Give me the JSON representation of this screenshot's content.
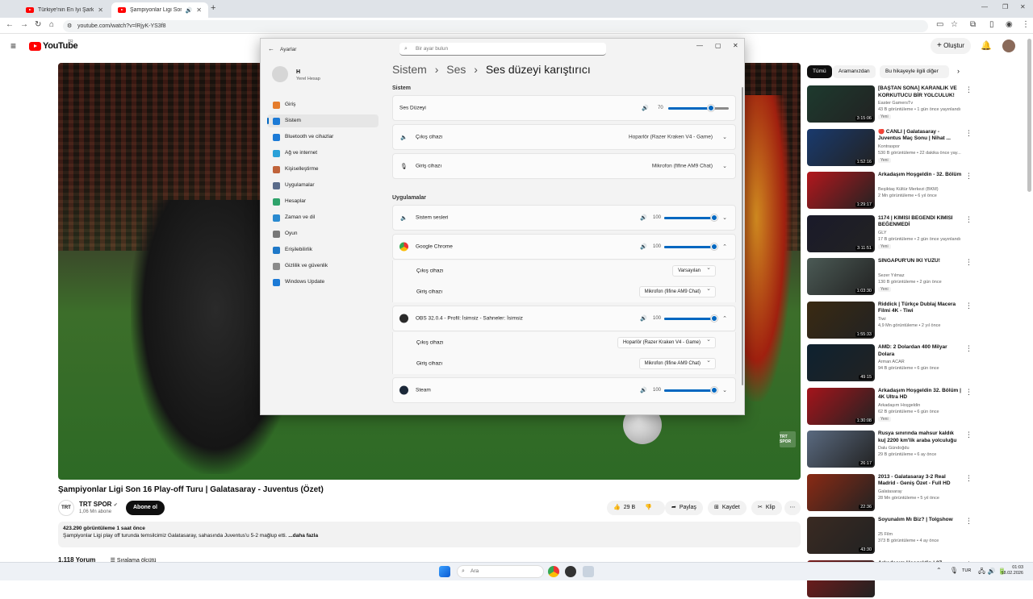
{
  "browser": {
    "tabs": [
      {
        "title": "Türkiye'nin En İyi Şarkıcısı mı? |"
      },
      {
        "title": "Şampiyonlar Ligi Son 16 Pla..."
      }
    ],
    "url": "youtube.com/watch?v=lRjyK-YS3f8"
  },
  "youtube": {
    "logo": "YouTube",
    "logo_sup": "TR",
    "create_label": "Oluştur",
    "video": {
      "title": "Şampiyonlar Ligi Son 16 Play-off Turu | Galatasaray - Juventus (Özet)",
      "watermark": "TRT SPOR",
      "channel_avatar": "TRT",
      "channel_name": "TRT SPOR",
      "subs": "1,06 Mn abone",
      "subscribe": "Abone ol",
      "likes": "29 B",
      "share": "Paylaş",
      "save": "Kaydet",
      "clip": "Klip",
      "views": "423.290 görüntüleme  1 saat önce",
      "description": "Şampiyonlar Ligi play off turunda temsilcimiz Galatasaray, sahasında Juventus'u 5-2 mağlup etti.",
      "more": "...daha fazla",
      "comments": "1.118 Yorum",
      "sort": "Sıralama ölçütü"
    },
    "chips": [
      "Tümü",
      "Aramanızdan",
      "Bu hikayeyle ilgili diğer"
    ],
    "recommendations": [
      {
        "title": "[BAŞTAN SONA] KARANLIK VE KORKUTUCU BİR YOLCULUK! -...",
        "channel": "Easter GamersTv",
        "views": "43 B görüntüleme • 1 gün önce yayınlandı",
        "badge": "Yeni",
        "duration": "3:15:06",
        "color": "#1d3a2e"
      },
      {
        "title": "🔴 CANLI | Galatasaray - Juventus Maç Sonu | Nihat ...",
        "channel": "Kontraspor",
        "views": "530 B görüntüleme • 22 dakika önce yay...",
        "badge": "Yeni",
        "duration": "1:52:16",
        "color": "#193a6e"
      },
      {
        "title": "Arkadaşım Hoşgeldin - 32. Bölüm",
        "channel": "Beşiktaş Kültür Merkezi (BKM)",
        "views": "2 Mn görüntüleme • 6 yıl önce",
        "badge": "",
        "duration": "1:29:17",
        "color": "#b3171d"
      },
      {
        "title": "1174 | KİMİSİ BEĞENDİ KİMİSİ BEĞENMEDİ",
        "channel": "GLY",
        "views": "17 B görüntüleme • 2 gün önce yayınlandı",
        "badge": "Yeni",
        "duration": "3:11:51",
        "color": "#1a1a2a"
      },
      {
        "title": "SİNGAPUR'UN İKİ YÜZÜ!",
        "channel": "Sezer Yılmaz",
        "views": "130 B görüntüleme • 2 gün önce",
        "badge": "Yeni",
        "duration": "1:03:30",
        "color": "#4b5a55"
      },
      {
        "title": "Riddick | Türkçe Dublaj Macera Filmi 4K - Tiwi",
        "channel": "Tiwi",
        "views": "4,9 Mn görüntüleme • 2 yıl önce",
        "badge": "",
        "duration": "1:55:33",
        "color": "#3a2a12"
      },
      {
        "title": "AMD: 2 Dolardan 400 Milyar Dolara",
        "channel": "Arman ACAR",
        "views": "94 B görüntüleme • 6 gün önce",
        "badge": "",
        "duration": "49:15",
        "color": "#0e2230"
      },
      {
        "title": "Arkadaşım Hoşgeldin 32. Bölüm | 4K Ultra HD",
        "channel": "Arkadaşım Hoşgeldin",
        "views": "62 B görüntüleme • 6 gün önce",
        "badge": "Yeni",
        "duration": "1:30:08",
        "color": "#a5141b"
      },
      {
        "title": "Rusya sınırında mahsur kaldık ku| 2200 km'lik araba yolculuğu",
        "channel": "Dalu Gündoğdu",
        "views": "29 B görüntüleme • 6 ay önce",
        "badge": "",
        "duration": "26:17",
        "color": "#5a6a80"
      },
      {
        "title": "2013 - Galatasaray 3-2 Real Madrid - Geniş Özet - Full HD",
        "channel": "Galatasaray",
        "views": "28 Mn görüntüleme • 5 yıl önce",
        "badge": "",
        "duration": "22:36",
        "color": "#8a2a14"
      },
      {
        "title": "Soyunalım Mı Biz? | Tolgshow",
        "channel": "25 Film",
        "views": "373 B görüntüleme • 4 ay önce",
        "badge": "",
        "duration": "43:30",
        "color": "#3a2a22"
      },
      {
        "title": "Arkadaşım Hoşgeldin | 37.",
        "channel": "",
        "views": "",
        "badge": "",
        "duration": "",
        "color": "#7a1a1a"
      }
    ]
  },
  "settings": {
    "window_title": "Ayarlar",
    "search_placeholder": "Bir ayar bulun",
    "user_name": "H",
    "user_sub": "Yerel Hesap",
    "nav": [
      {
        "label": "Giriş",
        "icon": "home-icon",
        "color": "#e57c2c"
      },
      {
        "label": "Sistem",
        "icon": "system-icon",
        "color": "#1c7ad6"
      },
      {
        "label": "Bluetooth ve cihazlar",
        "icon": "bluetooth-icon",
        "color": "#1c7ad6"
      },
      {
        "label": "Ağ ve internet",
        "icon": "network-icon",
        "color": "#2aa0d8"
      },
      {
        "label": "Kişiselleştirme",
        "icon": "brush-icon",
        "color": "#c0633a"
      },
      {
        "label": "Uygulamalar",
        "icon": "apps-icon",
        "color": "#5a6b8a"
      },
      {
        "label": "Hesaplar",
        "icon": "account-icon",
        "color": "#2fa36b"
      },
      {
        "label": "Zaman ve dil",
        "icon": "globe-clock-icon",
        "color": "#2a8ad0"
      },
      {
        "label": "Oyun",
        "icon": "gamepad-icon",
        "color": "#777777"
      },
      {
        "label": "Erişilebilirlik",
        "icon": "accessibility-icon",
        "color": "#1e78c8"
      },
      {
        "label": "Gizlilik ve güvenlik",
        "icon": "shield-icon",
        "color": "#8a8a8a"
      },
      {
        "label": "Windows Update",
        "icon": "update-icon",
        "color": "#1c7ad6"
      }
    ],
    "breadcrumb": [
      "Sistem",
      "Ses",
      "Ses düzeyi karıştırıcı"
    ],
    "section_system": "Sistem",
    "master_label": "Ses Düzeyi",
    "master_volume": "70",
    "output_label": "Çıkış cihazı",
    "output_value": "Hoparlör (Razer Kraken V4 - Game)",
    "input_label": "Giriş cihazı",
    "input_value": "Mikrofon (fifine AM9 Chat)",
    "section_apps": "Uygulamalar",
    "apps": [
      {
        "name": "Sistem sesleri",
        "volume": "100",
        "icon": "speaker-system-icon"
      },
      {
        "name": "Google Chrome",
        "volume": "100",
        "icon": "chrome-icon",
        "output": "Varsayılan",
        "input": "Mikrofon (fifine AM9 Chat)"
      },
      {
        "name": "OBS 32.0.4 - Profil: İsimsiz - Sahneler: İsimsiz",
        "volume": "100",
        "icon": "obs-icon",
        "output": "Hoparlör (Razer Kraken V4 - Game)",
        "input": "Mikrofon (fifine AM9 Chat)"
      },
      {
        "name": "Steam",
        "volume": "100",
        "icon": "steam-icon"
      }
    ],
    "sub_output_label": "Çıkış cihazı",
    "sub_input_label": "Giriş cihazı"
  },
  "taskbar": {
    "search_placeholder": "Ara",
    "lang": "TUR",
    "time": "01:03",
    "date": "18.02.2026"
  },
  "colors": {
    "accent": "#0067c0",
    "yt_red": "#ff0000"
  }
}
